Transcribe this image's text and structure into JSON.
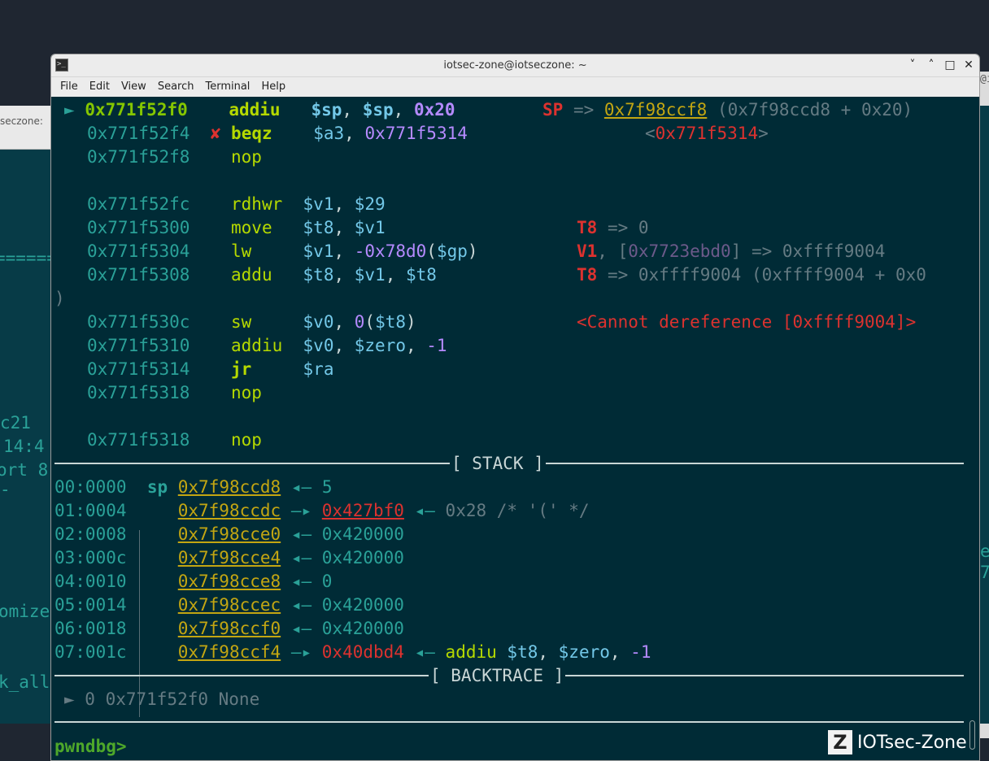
{
  "window": {
    "title": "iotsec-zone@iotseczone: ~",
    "icon": "terminal-icon",
    "controls": {
      "minimize": "˅",
      "maximize": "˄",
      "restore": "□",
      "close": "✕"
    }
  },
  "menu": [
    "File",
    "Edit",
    "View",
    "Search",
    "Terminal",
    "Help"
  ],
  "background": {
    "left_title": "seczone:",
    "left_lines": [
      "======",
      "c21",
      "14:4",
      "ort 8",
      "-",
      "omize",
      "k_all"
    ],
    "right_lines": [
      "@i",
      "e",
      "7"
    ]
  },
  "disasm": [
    {
      "marker": "►",
      "addr": "0x771f52f0",
      "mnemonic": "addiu",
      "ops": [
        "$sp",
        ", ",
        "$sp",
        ", ",
        "0x20"
      ],
      "comment": [
        "SP",
        " => ",
        "0x7f98ccf8",
        " (0x7f98ccd8 + 0x20)"
      ]
    },
    {
      "marker": "✘",
      "addr": "0x771f52f4",
      "mnemonic": "beqz",
      "ops": [
        "$a3",
        ", ",
        "0x771f5314"
      ],
      "comment": [
        "<",
        "0x771f5314",
        ">"
      ]
    },
    {
      "addr": "0x771f52f8",
      "mnemonic": "nop"
    },
    {
      "addr": "0x771f52fc",
      "mnemonic": "rdhwr",
      "ops": [
        "$v1",
        ", ",
        "$29"
      ]
    },
    {
      "addr": "0x771f5300",
      "mnemonic": "move",
      "ops": [
        "$t8",
        ", ",
        "$v1"
      ],
      "comment": [
        "T8",
        " => 0"
      ]
    },
    {
      "addr": "0x771f5304",
      "mnemonic": "lw",
      "ops": [
        "$v1",
        ", ",
        "-0x78d0",
        "(",
        "$gp",
        ")"
      ],
      "comment": [
        "V1",
        ", ",
        "[",
        "0x7723ebd0",
        "]",
        " => 0xffff9004"
      ]
    },
    {
      "addr": "0x771f5308",
      "mnemonic": "addu",
      "ops": [
        "$t8",
        ", ",
        "$v1",
        ", ",
        "$t8"
      ],
      "comment": [
        "T8",
        " => 0xffff9004 (0xffff9004 + 0x0"
      ],
      "wrap": ")"
    },
    {
      "addr": "0x771f530c",
      "mnemonic": "sw",
      "ops": [
        "$v0",
        ", ",
        "0",
        "(",
        "$t8",
        ")"
      ],
      "comment": [
        "<Cannot dereference [0xffff9004]>"
      ]
    },
    {
      "addr": "0x771f5310",
      "mnemonic": "addiu",
      "ops": [
        "$v0",
        ", ",
        "$zero",
        ", ",
        "-1"
      ]
    },
    {
      "addr": "0x771f5314",
      "mnemonic": "jr",
      "ops": [
        "$ra"
      ]
    },
    {
      "addr": "0x771f5318",
      "mnemonic": "nop"
    },
    {
      "addr": "0x771f5318",
      "mnemonic": "nop"
    }
  ],
  "stack": {
    "header": "[ STACK ]",
    "sp_label": "sp",
    "rows": [
      {
        "idx": "00:0000",
        "addr": "0x7f98ccd8",
        "arrow": "◂—",
        "value": "5"
      },
      {
        "idx": "01:0004",
        "addr": "0x7f98ccdc",
        "arrow": "—▸",
        "value": "0x427bf0",
        "arrow2": "◂—",
        "extra": "0x28 /* '(' */"
      },
      {
        "idx": "02:0008",
        "addr": "0x7f98cce0",
        "arrow": "◂—",
        "value": "0x420000"
      },
      {
        "idx": "03:000c",
        "addr": "0x7f98cce4",
        "arrow": "◂—",
        "value": "0x420000"
      },
      {
        "idx": "04:0010",
        "addr": "0x7f98cce8",
        "arrow": "◂—",
        "value": "0"
      },
      {
        "idx": "05:0014",
        "addr": "0x7f98ccec",
        "arrow": "◂—",
        "value": "0x420000"
      },
      {
        "idx": "06:0018",
        "addr": "0x7f98ccf0",
        "arrow": "◂—",
        "value": "0x420000"
      },
      {
        "idx": "07:001c",
        "addr": "0x7f98ccf4",
        "arrow": "—▸",
        "value": "0x40dbd4",
        "arrow2": "◂—",
        "extra_mn": "addiu",
        "extra_ops": [
          "$t8",
          ", ",
          "$zero",
          ", ",
          "-1"
        ]
      }
    ]
  },
  "backtrace": {
    "header": "[ BACKTRACE ]",
    "line": "► 0 0x771f52f0 None"
  },
  "prompt": "pwndbg>",
  "watermark": {
    "logo": "Z",
    "text": "IOTsec-Zone"
  }
}
